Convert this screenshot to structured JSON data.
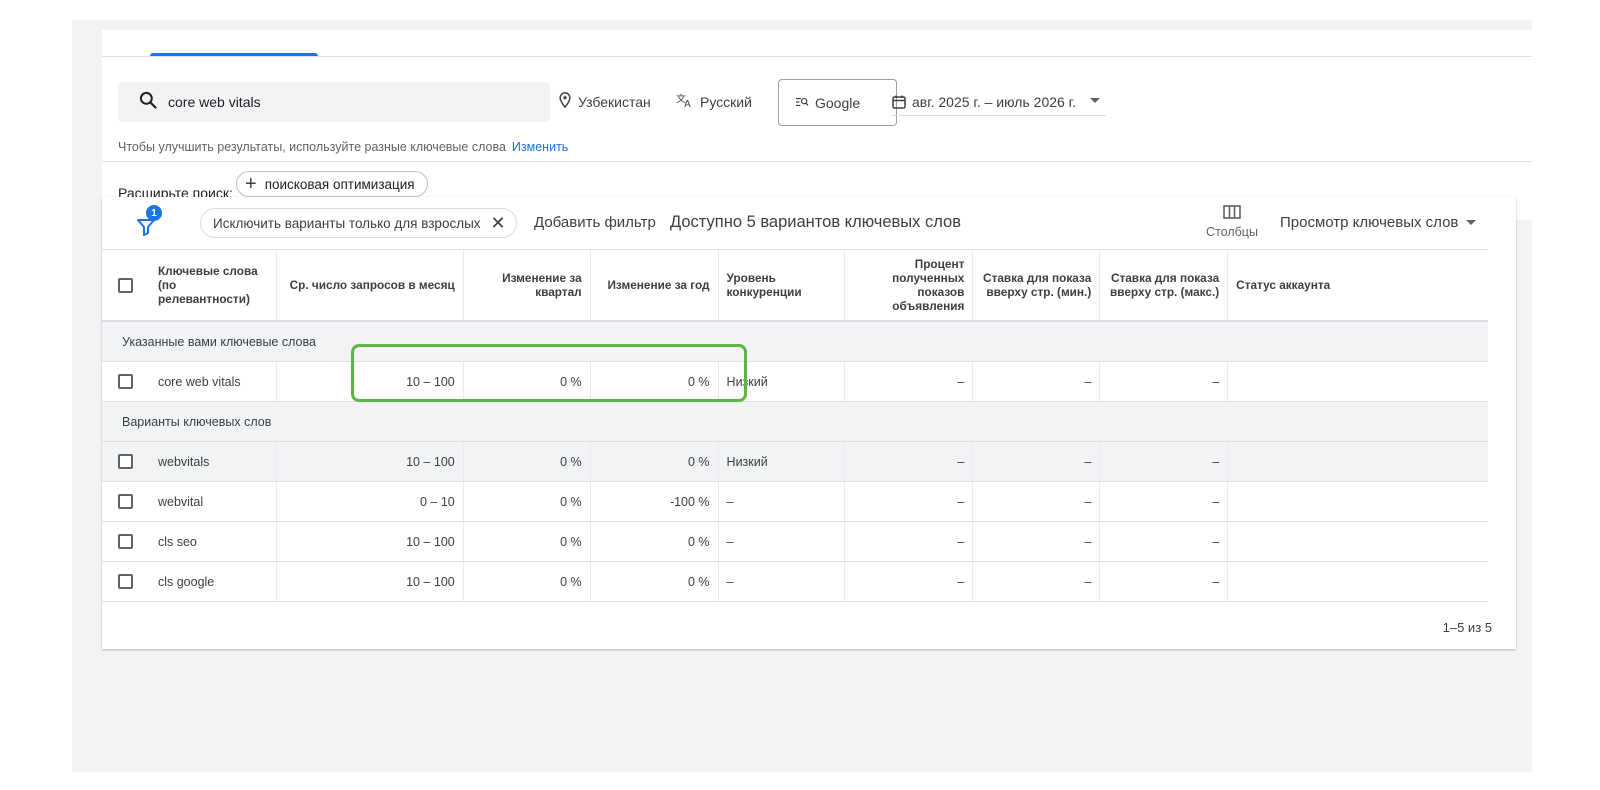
{
  "search": {
    "query": "core web vitals"
  },
  "filters": {
    "location": "Узбекистан",
    "language": "Русский",
    "network": "Google",
    "date_range": "авг. 2025 г. – июль 2026 г."
  },
  "hint": {
    "text": "Чтобы улучшить результаты, используйте разные ключевые слова",
    "link": "Изменить"
  },
  "expand": {
    "label": "Расширьте поиск:",
    "chip": "поисковая оптимизация"
  },
  "toolbar": {
    "filter_badge": "1",
    "adult_chip": "Исключить варианты только для взрослых",
    "add_filter": "Добавить фильтр",
    "available": "Доступно 5 вариантов ключевых слов",
    "columns": "Столбцы",
    "view": "Просмотр ключевых слов"
  },
  "table": {
    "headers": [
      "Ключевые слова (по релевантности)",
      "Ср. число запросов в месяц",
      "Изменение за квартал",
      "Изменение за год",
      "Уровень конкуренции",
      "Процент полученных показов объявления",
      "Ставка для показа вверху стр. (мин.)",
      "Ставка для показа вверху стр. (макс.)",
      "Статус аккаунта"
    ],
    "group1": "Указанные вами ключевые слова",
    "group2": "Варианты ключевых слов",
    "rows": [
      {
        "kw": "core web vitals",
        "avg": "10 – 100",
        "q": "0 %",
        "y": "0 %",
        "comp": "Низкий",
        "imp": "–",
        "min": "–",
        "max": "–",
        "status": ""
      },
      {
        "kw": "webvitals",
        "avg": "10 – 100",
        "q": "0 %",
        "y": "0 %",
        "comp": "Низкий",
        "imp": "–",
        "min": "–",
        "max": "–",
        "status": ""
      },
      {
        "kw": "webvital",
        "avg": "0 – 10",
        "q": "0 %",
        "y": "-100 %",
        "comp": "–",
        "imp": "–",
        "min": "–",
        "max": "–",
        "status": ""
      },
      {
        "kw": "cls seo",
        "avg": "10 – 100",
        "q": "0 %",
        "y": "0 %",
        "comp": "–",
        "imp": "–",
        "min": "–",
        "max": "–",
        "status": ""
      },
      {
        "kw": "cls google",
        "avg": "10 – 100",
        "q": "0 %",
        "y": "0 %",
        "comp": "–",
        "imp": "–",
        "min": "–",
        "max": "–",
        "status": ""
      }
    ],
    "pagination": "1–5 из 5"
  },
  "colors": {
    "accent": "#1a73e8",
    "highlight": "#5cb545"
  }
}
